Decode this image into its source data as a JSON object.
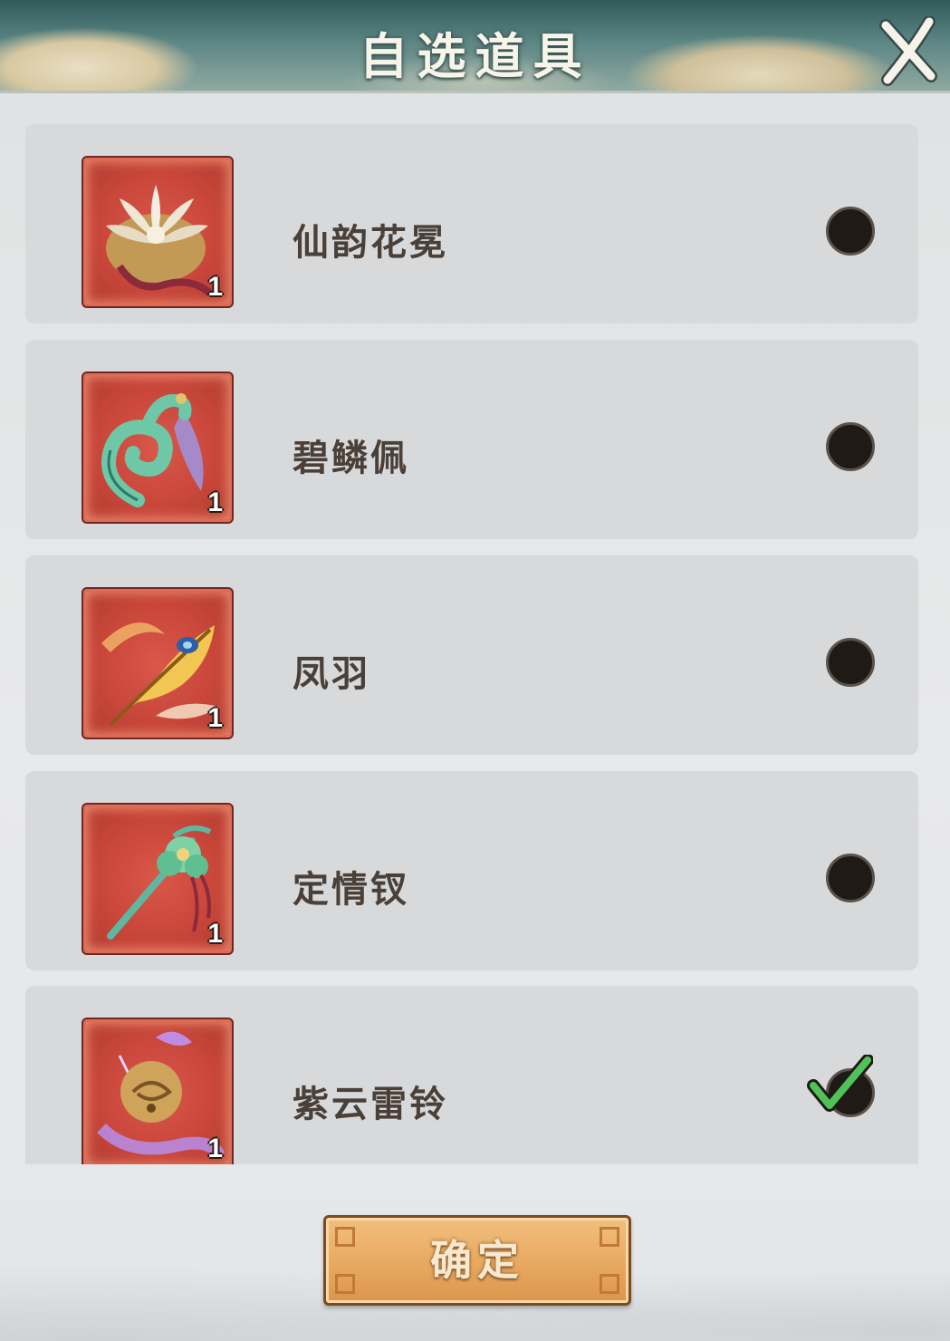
{
  "dialog": {
    "title": "自选道具"
  },
  "items": [
    {
      "name": "仙韵花冕",
      "count": "1",
      "icon": "lotus-crown-icon",
      "selected": false
    },
    {
      "name": "碧鳞佩",
      "count": "1",
      "icon": "jade-pendant-icon",
      "selected": false
    },
    {
      "name": "凤羽",
      "count": "1",
      "icon": "phoenix-feather-icon",
      "selected": false
    },
    {
      "name": "定情钗",
      "count": "1",
      "icon": "hairpin-icon",
      "selected": false
    },
    {
      "name": "紫云雷铃",
      "count": "1",
      "icon": "thunder-bell-icon",
      "selected": true
    }
  ],
  "confirm_label": "确定",
  "colors": {
    "header": "#5b8583",
    "row_bg": "#d7d9db",
    "item_frame": "#c8463a",
    "radio": "#1f1a15",
    "check": "#4caf50",
    "confirm": "#e9ab63"
  }
}
